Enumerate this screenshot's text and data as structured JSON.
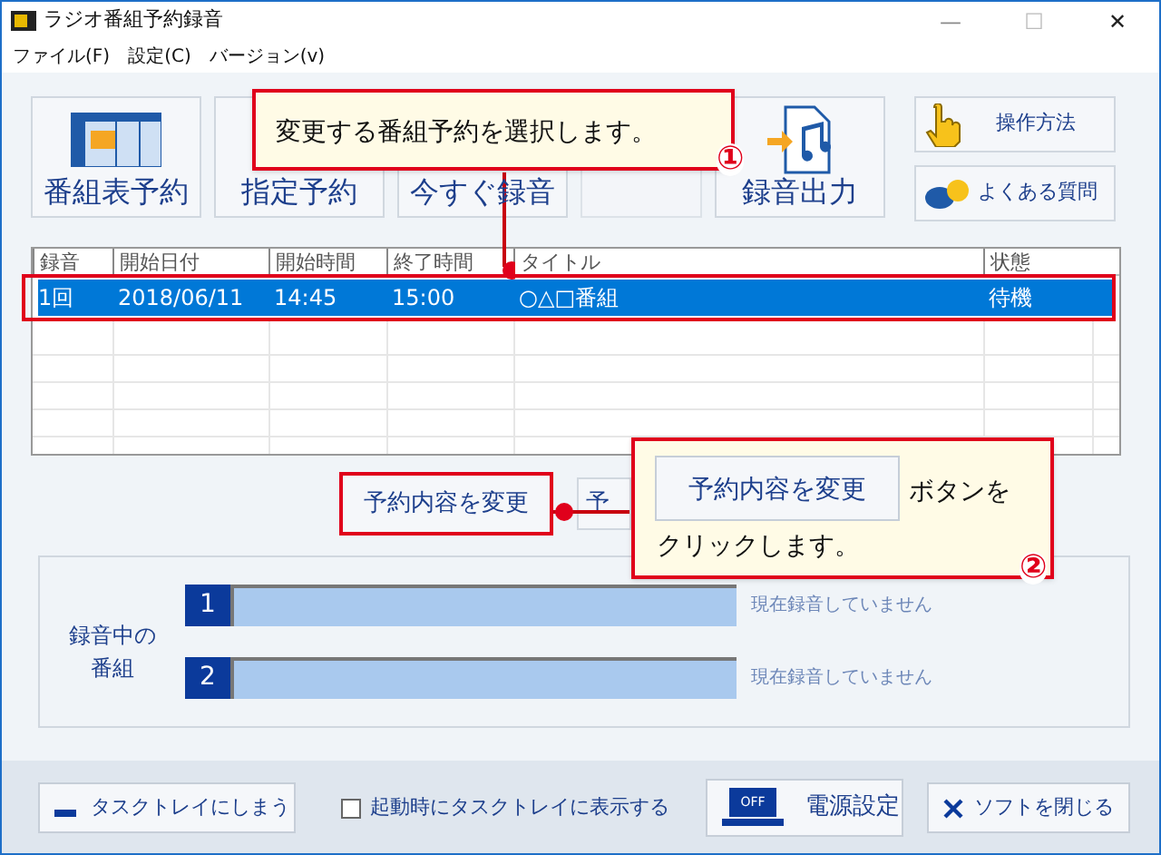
{
  "window": {
    "title": "ラジオ番組予約録音",
    "controls": [
      "—",
      "☐",
      "✕"
    ]
  },
  "menu": [
    "ファイル(F)",
    "設定(C)",
    "バージョン(v)"
  ],
  "toolbar": [
    {
      "label": "番組表予約",
      "kind": "schedule",
      "disabled": false
    },
    {
      "label": "指定予約",
      "kind": "text",
      "disabled": false
    },
    {
      "label": "今すぐ録音",
      "kind": "text",
      "disabled": false
    },
    {
      "kind": "text",
      "disabled": true
    },
    {
      "label": "録音出力",
      "kind": "export",
      "disabled": false
    }
  ],
  "help_buttons": [
    {
      "label": "操作方法",
      "kind": "hand"
    },
    {
      "label": "よくある質問",
      "kind": "qa"
    }
  ],
  "table": {
    "columns": [
      "録音",
      "開始日付",
      "開始時間",
      "終了時間",
      "タイトル",
      "状態"
    ],
    "rows": [
      {
        "cells": [
          "1回",
          "2018/06/11",
          "14:45",
          "15:00",
          "○△□番組",
          "待機"
        ],
        "selected": true
      }
    ]
  },
  "actions": [
    "予約内容を変更",
    "予"
  ],
  "recording": {
    "label": "録音中の番組",
    "channels": [
      {
        "number": "1",
        "status": "現在録音していません",
        "level": 0
      },
      {
        "number": "2",
        "status": "現在録音していません",
        "level": 0
      }
    ]
  },
  "footer": {
    "tray_button": "タスクトレイにしまう",
    "startup_checkbox": {
      "label": "起動時にタスクトレイに表示する",
      "checked": false
    },
    "power_button": "電源設定",
    "power_icon_text": "OFF",
    "close_button": "ソフトを閉じる"
  },
  "callouts": [
    {
      "text": "変更する番組予約を選択します。",
      "number": "①"
    },
    {
      "button_text": "予約内容を変更",
      "text_1": "ボタンを",
      "text_2": "クリックします。",
      "number": "②"
    }
  ]
}
